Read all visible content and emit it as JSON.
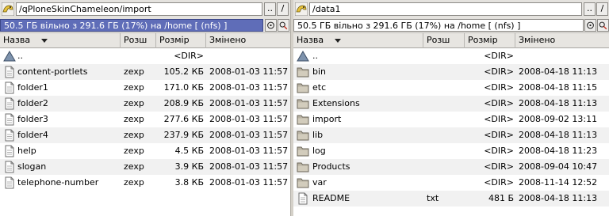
{
  "left": {
    "path": "/qPloneSkinChameleon/import",
    "btn_up": "..",
    "btn_root": "/",
    "status": "50.5 ГБ вільно з 291.6 ГБ (17%) на /home [ (nfs) ]",
    "columns": {
      "name": "Назва",
      "ext": "Розш",
      "size": "Розмір",
      "modified": "Змінено"
    },
    "files": [
      {
        "icon": "parent-dir",
        "name": "..",
        "ext": "",
        "size": "<DIR>",
        "date": ""
      },
      {
        "icon": "file",
        "name": "content-portlets",
        "ext": "zexp",
        "size": "105.2 КБ",
        "date": "2008-01-03 11:57"
      },
      {
        "icon": "file",
        "name": "folder1",
        "ext": "zexp",
        "size": "171.0 КБ",
        "date": "2008-01-03 11:57"
      },
      {
        "icon": "file",
        "name": "folder2",
        "ext": "zexp",
        "size": "208.9 КБ",
        "date": "2008-01-03 11:57"
      },
      {
        "icon": "file",
        "name": "folder3",
        "ext": "zexp",
        "size": "277.6 КБ",
        "date": "2008-01-03 11:57"
      },
      {
        "icon": "file",
        "name": "folder4",
        "ext": "zexp",
        "size": "237.9 КБ",
        "date": "2008-01-03 11:57"
      },
      {
        "icon": "file",
        "name": "help",
        "ext": "zexp",
        "size": "4.5 КБ",
        "date": "2008-01-03 11:57"
      },
      {
        "icon": "file",
        "name": "slogan",
        "ext": "zexp",
        "size": "3.9 КБ",
        "date": "2008-01-03 11:57"
      },
      {
        "icon": "file",
        "name": "telephone-number",
        "ext": "zexp",
        "size": "3.8 КБ",
        "date": "2008-01-03 11:57"
      }
    ]
  },
  "right": {
    "path": "/data1",
    "btn_up": "..",
    "btn_root": "/",
    "status": "50.5 ГБ вільно з 291.6 ГБ (17%) на /home [ (nfs) ]",
    "columns": {
      "name": "Назва",
      "ext": "Розш",
      "size": "Розмір",
      "modified": "Змінено"
    },
    "files": [
      {
        "icon": "parent-dir",
        "name": "..",
        "ext": "",
        "size": "<DIR>",
        "date": ""
      },
      {
        "icon": "folder",
        "name": "bin",
        "ext": "",
        "size": "<DIR>",
        "date": "2008-04-18 11:13"
      },
      {
        "icon": "folder",
        "name": "etc",
        "ext": "",
        "size": "<DIR>",
        "date": "2008-04-18 11:15"
      },
      {
        "icon": "folder",
        "name": "Extensions",
        "ext": "",
        "size": "<DIR>",
        "date": "2008-04-18 11:13"
      },
      {
        "icon": "folder",
        "name": "import",
        "ext": "",
        "size": "<DIR>",
        "date": "2008-09-02 13:11"
      },
      {
        "icon": "folder",
        "name": "lib",
        "ext": "",
        "size": "<DIR>",
        "date": "2008-04-18 11:13"
      },
      {
        "icon": "folder",
        "name": "log",
        "ext": "",
        "size": "<DIR>",
        "date": "2008-04-18 11:23"
      },
      {
        "icon": "folder",
        "name": "Products",
        "ext": "",
        "size": "<DIR>",
        "date": "2008-09-04 10:47"
      },
      {
        "icon": "folder",
        "name": "var",
        "ext": "",
        "size": "<DIR>",
        "date": "2008-11-14 12:52"
      },
      {
        "icon": "file",
        "name": "README",
        "ext": "txt",
        "size": "481 Б",
        "date": "2008-04-18 11:13"
      }
    ]
  }
}
